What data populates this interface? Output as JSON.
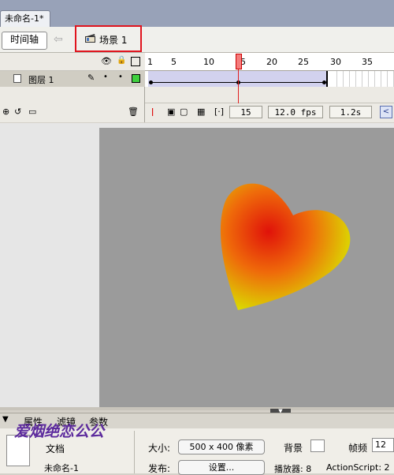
{
  "document": {
    "tab_title": "未命名-1*"
  },
  "edit_bar": {
    "timeline_button": "时间轴",
    "back_arrow": "⇦",
    "scene_label": "场景 1"
  },
  "timeline": {
    "ruler_ticks": [
      "1",
      "5",
      "10",
      "15",
      "20",
      "25",
      "30",
      "35"
    ],
    "layer_name": "图层 1",
    "current_frame": "15",
    "frame_rate": "12.0 fps",
    "elapsed_time": "1.2s"
  },
  "properties": {
    "tabs": [
      "属性",
      "滤镜",
      "参数"
    ],
    "doc_type": "文档",
    "doc_name": "未命名-1",
    "size_label": "大小:",
    "size_value": "500 x 400 像素",
    "publish_label": "发布:",
    "publish_button": "设置...",
    "background_label": "背景",
    "frame_rate_label": "帧频",
    "frame_rate_value": "12",
    "player_label": "播放器: 8",
    "actionscript_label": "ActionScript: 2"
  },
  "watermark": "爱烟绝恋公公",
  "colors": {
    "keyframe_indicator": "#e01e1e",
    "stage": "#9b9b9b",
    "heart_center": "#e0120a",
    "heart_edge": "#d7f000",
    "layer_color": "#3ed03e"
  }
}
